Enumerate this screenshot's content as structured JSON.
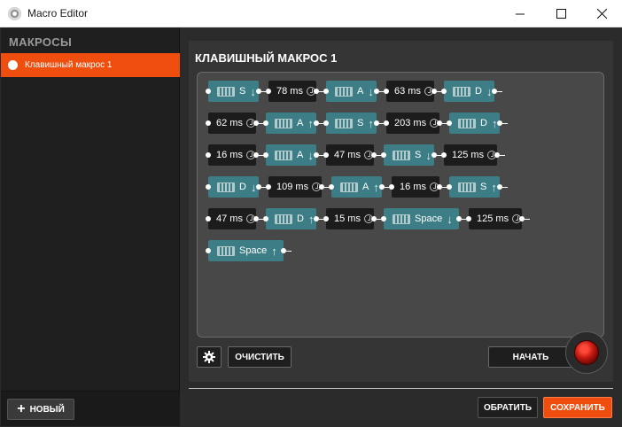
{
  "window": {
    "title": "Macro Editor",
    "icons": {
      "app": "disc-icon",
      "minimize": "minimize-icon",
      "maximize": "maximize-icon",
      "close": "close-icon"
    }
  },
  "sidebar": {
    "title": "МАКРОСЫ",
    "items": [
      {
        "label": "Клавишный макрос 1",
        "selected": true
      }
    ],
    "new_label": "НОВЫЙ"
  },
  "panel": {
    "title": "КЛАВИШНЫЙ МАКРОС 1",
    "clear_label": "ОЧИСТИТЬ",
    "start_label": "НАЧАТЬ"
  },
  "footer": {
    "invert_label": "ОБРАТИТЬ",
    "save_label": "СОХРАНИТЬ"
  },
  "colors": {
    "accent": "#f04e0f",
    "key_node": "#3d7e86",
    "delay_node": "#1c1c1c",
    "background": "#2b2b2b"
  },
  "macro": {
    "rows": [
      [
        {
          "type": "key",
          "label": "S",
          "dir": "down"
        },
        {
          "type": "delay",
          "label": "78 ms"
        },
        {
          "type": "key",
          "label": "A",
          "dir": "down"
        },
        {
          "type": "delay",
          "label": "63 ms"
        },
        {
          "type": "key",
          "label": "D",
          "dir": "down"
        }
      ],
      [
        {
          "type": "delay",
          "label": "62 ms"
        },
        {
          "type": "key",
          "label": "A",
          "dir": "up"
        },
        {
          "type": "key",
          "label": "S",
          "dir": "up"
        },
        {
          "type": "delay",
          "label": "203 ms"
        },
        {
          "type": "key",
          "label": "D",
          "dir": "up"
        }
      ],
      [
        {
          "type": "delay",
          "label": "16 ms"
        },
        {
          "type": "key",
          "label": "A",
          "dir": "down"
        },
        {
          "type": "delay",
          "label": "47 ms"
        },
        {
          "type": "key",
          "label": "S",
          "dir": "down"
        },
        {
          "type": "delay",
          "label": "125 ms"
        }
      ],
      [
        {
          "type": "key",
          "label": "D",
          "dir": "down"
        },
        {
          "type": "delay",
          "label": "109 ms"
        },
        {
          "type": "key",
          "label": "A",
          "dir": "up"
        },
        {
          "type": "delay",
          "label": "16 ms"
        },
        {
          "type": "key",
          "label": "S",
          "dir": "up"
        }
      ],
      [
        {
          "type": "delay",
          "label": "47 ms"
        },
        {
          "type": "key",
          "label": "D",
          "dir": "up"
        },
        {
          "type": "delay",
          "label": "15 ms"
        },
        {
          "type": "key",
          "label": "Space",
          "dir": "down"
        },
        {
          "type": "delay",
          "label": "125 ms"
        }
      ],
      [
        {
          "type": "key",
          "label": "Space",
          "dir": "up"
        }
      ]
    ]
  }
}
